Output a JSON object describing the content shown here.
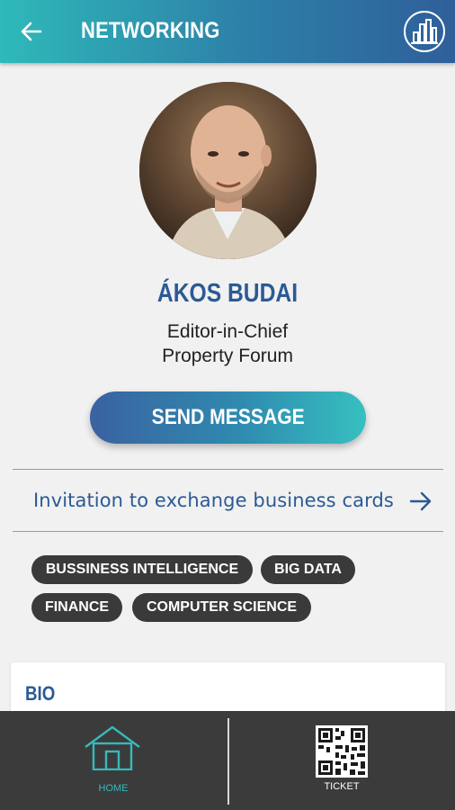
{
  "header": {
    "title": "NETWORKING",
    "back_icon": "arrow-left-icon",
    "stats_icon": "bar-chart-icon"
  },
  "profile": {
    "name": "ÁKOS BUDAI",
    "title": "Editor-in-Chief",
    "company": "Property Forum",
    "avatar": "profile-photo"
  },
  "actions": {
    "send_message": "SEND MESSAGE",
    "invitation": "Invitation to exchange business cards",
    "invitation_icon": "arrow-right-icon"
  },
  "tags": [
    "BUSSINESS INTELLIGENCE",
    "BIG DATA",
    "FINANCE",
    "COMPUTER SCIENCE"
  ],
  "bio": {
    "title": "BIO"
  },
  "bottom_nav": {
    "home": {
      "label": "HOME",
      "icon": "home-icon",
      "active": true
    },
    "ticket": {
      "label": "TICKET",
      "icon": "qr-code-icon",
      "active": false
    }
  },
  "colors": {
    "accent_blue": "#2b5a95",
    "accent_teal": "#38b9b9",
    "tag_bg": "#3a3a3a",
    "nav_bg": "#3b3b3b"
  }
}
